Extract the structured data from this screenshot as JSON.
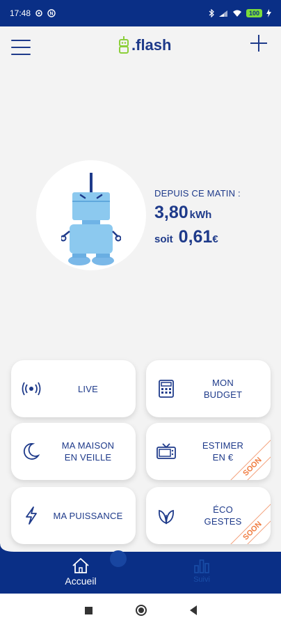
{
  "status_bar": {
    "time": "17:48",
    "left_icons": [
      "settings-icon",
      "notification-icon"
    ],
    "battery": "100",
    "right_icons": [
      "bluetooth-icon",
      "signal-icon",
      "wifi-icon",
      "battery-icon",
      "charging-icon"
    ]
  },
  "header": {
    "logo_text": ".flash",
    "menu_icon": "hamburger-icon",
    "add_icon": "plus-icon"
  },
  "consumption": {
    "since_label": "DEPUIS CE MATIN :",
    "kwh_value": "3,80",
    "kwh_unit": "kWh",
    "soit": "soit",
    "euro_value": "0,61",
    "euro_unit": "€"
  },
  "cards": [
    {
      "line1": "LIVE",
      "line2": "",
      "icon": "live-signal-icon",
      "soon": ""
    },
    {
      "line1": "MON",
      "line2": "BUDGET",
      "icon": "calculator-icon",
      "soon": ""
    },
    {
      "line1": "MA MAISON",
      "line2": "EN VEILLE",
      "icon": "moon-icon",
      "soon": ""
    },
    {
      "line1": "ESTIMER",
      "line2": "EN €",
      "icon": "tv-icon",
      "soon": "SOON"
    },
    {
      "line1": "MA PUISSANCE",
      "line2": "",
      "icon": "lightning-icon",
      "soon": ""
    },
    {
      "line1": "ÉCO",
      "line2": "GESTES",
      "icon": "leaf-icon",
      "soon": "SOON"
    }
  ],
  "bottom_nav": {
    "home_label": "Accueil",
    "track_label": "Suivi"
  },
  "colors": {
    "primary": "#1e3a8a",
    "status_bar": "#0a2f86",
    "soon": "#f07b3f",
    "robot": "#87c5ee",
    "logo_accent": "#8ccf3a"
  }
}
